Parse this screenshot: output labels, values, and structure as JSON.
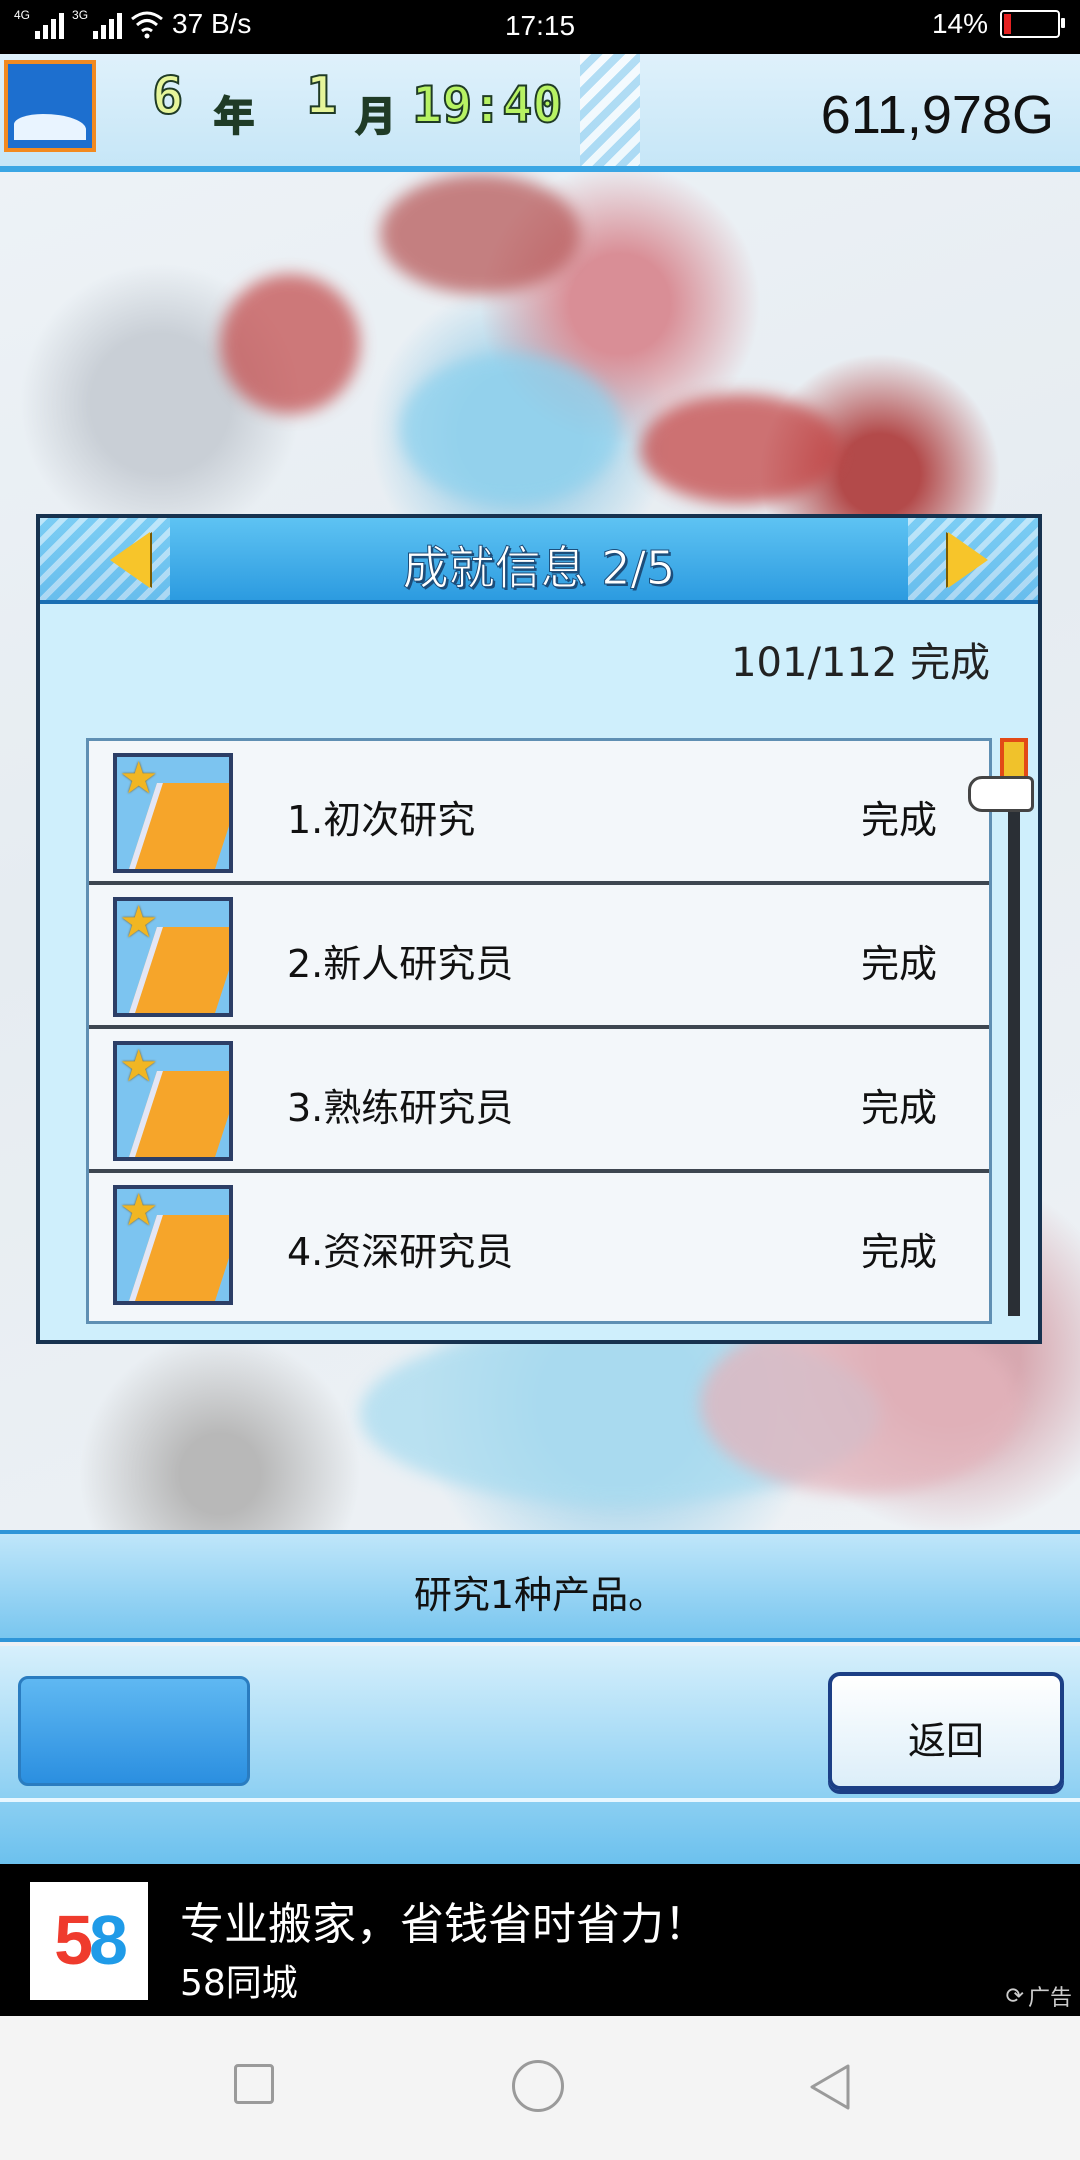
{
  "status_bar": {
    "network_left": "4G",
    "network_right": "3G",
    "speed": "37 B/s",
    "time": "17:15",
    "battery": "14%",
    "battery_level": 0.14
  },
  "hud": {
    "year_num": "6",
    "year_unit": "年",
    "month_num": "1",
    "month_unit": "月",
    "time": "19:40",
    "gold": "611,978G"
  },
  "dialog": {
    "title": "成就信息 2/5",
    "progress": "101/112 完成",
    "items": [
      {
        "label": "1.初次研究",
        "state": "完成"
      },
      {
        "label": "2.新人研究员",
        "state": "完成"
      },
      {
        "label": "3.熟练研究员",
        "state": "完成"
      },
      {
        "label": "4.资深研究员",
        "state": "完成"
      }
    ]
  },
  "description": "研究1种产品。",
  "buttons": {
    "back": "返回"
  },
  "ad": {
    "logo_text_1": "5",
    "logo_text_2": "8",
    "headline": "专业搬家，省钱省时省力！",
    "advertiser": "58同城",
    "tag": "广告"
  },
  "colors": {
    "accent_blue": "#2e95d8",
    "dialog_bg": "#cfeffc",
    "battery_low": "#e52222"
  }
}
